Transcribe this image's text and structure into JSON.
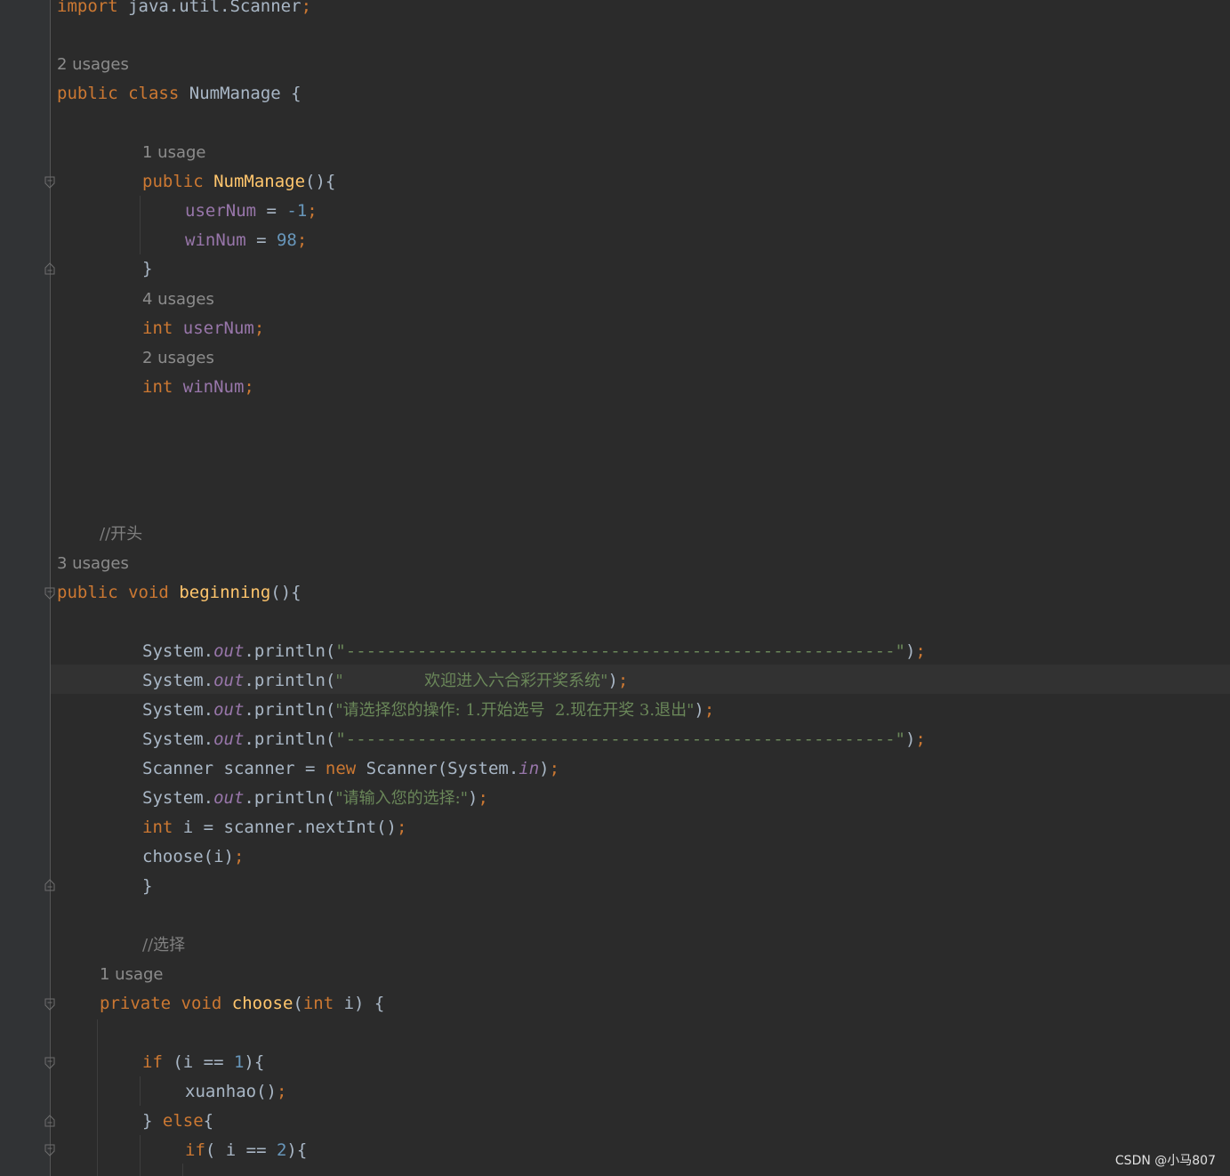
{
  "editor": {
    "import_line": {
      "kw": "import",
      "path": "java.util.Scanner",
      "semi": ";"
    },
    "hints": {
      "class": "2 usages",
      "ctor": "1 usage",
      "userNum": "4 usages",
      "winNum": "2 usages",
      "beginning": "3 usages",
      "choose": "1 usage"
    },
    "class_decl": {
      "kw1": "public",
      "kw2": "class",
      "name": "NumManage",
      "brace": " {"
    },
    "ctor": {
      "kw": "public",
      "name": "NumManage",
      "open": "(){",
      "close": "}"
    },
    "ctor_body": [
      {
        "field": "userNum",
        "op": " = ",
        "value": "-1",
        "semi": ";"
      },
      {
        "field": "winNum",
        "op": " = ",
        "value": "98",
        "semi": ";"
      }
    ],
    "fields": [
      {
        "type": "int",
        "name": "userNum",
        "semi": ";"
      },
      {
        "type": "int",
        "name": "winNum",
        "semi": ";"
      }
    ],
    "comments": {
      "beginning": "//开头",
      "choose": "//选择"
    },
    "beginning_decl": {
      "kw1": "public",
      "kw2": "void",
      "name": "beginning",
      "open": "(){"
    },
    "println": {
      "obj": "System.",
      "field": "out",
      "method": ".println(",
      "close": ")",
      "semi": ";"
    },
    "strings": {
      "divider": "\"------------------------------------------------------\"",
      "welcome": "\"                欢迎进入六合彩开奖系统\"",
      "menu": "\"请选择您的操作: 1.开始选号  2.现在开奖 3.退出\"",
      "prompt": "\"请输入您的选择:\""
    },
    "scanner_line": {
      "type": "Scanner scanner = ",
      "kw": "new",
      "ctor": " Scanner(System.",
      "field": "in",
      "close": ")",
      "semi": ";"
    },
    "nextint_line": {
      "kw": "int",
      "rest": " i = scanner.nextInt()",
      "semi": ";"
    },
    "choose_call": {
      "text": "choose(i)",
      "semi": ";"
    },
    "close_brace": "}",
    "choose_decl": {
      "kw1": "private",
      "kw2": "void",
      "name": "choose",
      "open": "(",
      "ptype": "int",
      "rest": " i) {"
    },
    "if1": {
      "kw": "if",
      "a": " (i == ",
      "num": "1",
      "b": "){"
    },
    "xuanhao": {
      "text": "xuanhao()",
      "semi": ";"
    },
    "else_line": {
      "brace": "} ",
      "kw": "else",
      "open": "{"
    },
    "if2": {
      "kw": "if",
      "a": "( i == ",
      "num": "2",
      "b": "){"
    }
  },
  "watermark": "CSDN @小马807"
}
